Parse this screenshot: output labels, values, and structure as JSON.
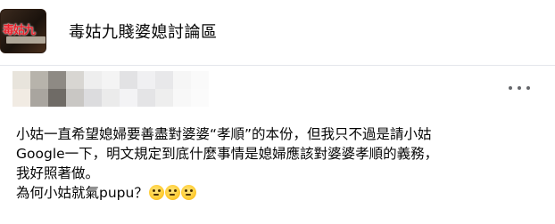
{
  "group": {
    "name": "毒姑九賤婆媳討論區",
    "avatar_text": "毒姑九"
  },
  "post": {
    "lines": [
      "小姑一直希望媳婦要善盡對婆婆“孝順”的本份，但我只不過是請小姑",
      "Google一下，明文規定到底什麼事情是媳婦應該對婆婆孝順的義務，",
      "我好照著做。",
      "為何小姑就氣pupu？"
    ],
    "emojis": [
      "thinking-face-emoji",
      "thinking-face-emoji",
      "thinking-face-emoji"
    ]
  },
  "icons": {
    "more": "more-horizontal-icon"
  },
  "colors": {
    "text": "#050505",
    "secondary": "#65676b",
    "divider": "#e4e6eb"
  }
}
